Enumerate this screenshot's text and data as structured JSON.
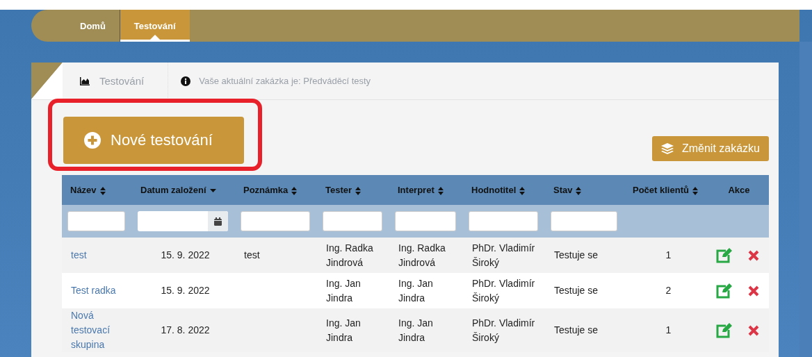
{
  "nav": {
    "tabs": [
      {
        "label": "Domů",
        "selected": false
      },
      {
        "label": "Testování",
        "selected": true
      }
    ]
  },
  "panel": {
    "breadcrumb": "Testování",
    "notice": "Vaše aktuální zakázka je: Předváděcí testy"
  },
  "new_button": {
    "label": "Nové testování",
    "highlighted": true
  },
  "change_button": {
    "label": "Změnit zakázku"
  },
  "table": {
    "columns": [
      {
        "label": "Název",
        "sortable": true,
        "sorted": false
      },
      {
        "label": "Datum založení",
        "sortable": true,
        "sorted": true
      },
      {
        "label": "Poznámka",
        "sortable": true,
        "sorted": false
      },
      {
        "label": "Tester",
        "sortable": true,
        "sorted": false
      },
      {
        "label": "Interpret",
        "sortable": true,
        "sorted": false
      },
      {
        "label": "Hodnotitel",
        "sortable": true,
        "sorted": false
      },
      {
        "label": "Stav",
        "sortable": true,
        "sorted": false
      },
      {
        "label": "Počet klientů",
        "sortable": true,
        "sorted": false
      },
      {
        "label": "Akce",
        "sortable": false
      }
    ],
    "filters": [
      {
        "kind": "text"
      },
      {
        "kind": "date"
      },
      {
        "kind": "text"
      },
      {
        "kind": "text"
      },
      {
        "kind": "text"
      },
      {
        "kind": "text"
      },
      {
        "kind": "text"
      },
      {
        "kind": "none"
      },
      {
        "kind": "none"
      }
    ],
    "rows": [
      {
        "name": "test",
        "date": "15. 9. 2022",
        "note": "test",
        "tester": "Ing. Radka Jindrová",
        "interpret": "Ing. Radka Jindrová",
        "evaluator": "PhDr. Vladimír Široký",
        "state": "Testuje se",
        "clients": "1"
      },
      {
        "name": "Test radka",
        "date": "15. 9. 2022",
        "tester": "Ing. Jan Jindra",
        "interpret": "Ing. Jan Jindra",
        "evaluator": "PhDr. Vladimír Široký",
        "state": "Testuje se",
        "clients": "2"
      },
      {
        "name": "Nová testovací skupina",
        "date": "17. 8. 2022",
        "tester": "Ing. Jan Jindra",
        "interpret": "Ing. Jan Jindra",
        "evaluator": "PhDr. Vladimír Široký",
        "state": "Testuje se",
        "clients": "1"
      }
    ]
  }
}
